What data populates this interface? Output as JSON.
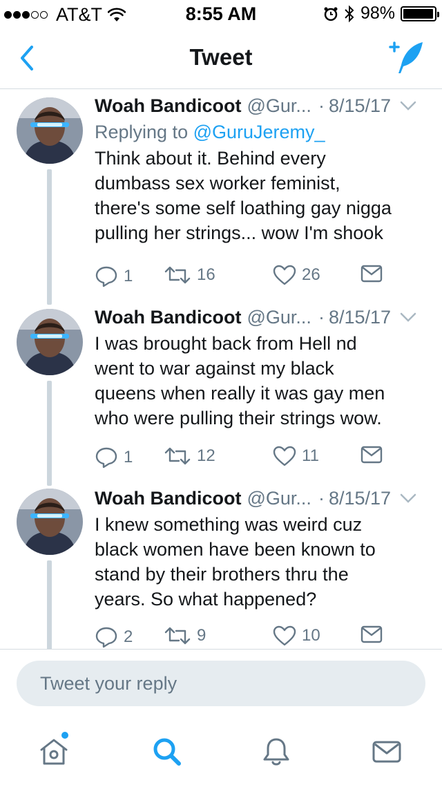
{
  "status_bar": {
    "carrier": "AT&T",
    "time": "8:55 AM",
    "battery_percent": "98%",
    "battery_level": 0.98,
    "signal_bars": [
      true,
      true,
      true,
      false,
      false
    ]
  },
  "nav": {
    "title": "Tweet",
    "back_icon": "chevron-left-icon",
    "compose_icon": "compose-tweet-icon"
  },
  "tweets": [
    {
      "author": "Woah Bandicoot",
      "handle": "@Gur...",
      "separator": "·",
      "date": "8/15/17",
      "replying_prefix": "Replying to ",
      "replying_to": "@GuruJeremy_",
      "text": "Think about it. Behind every\ndumbass sex worker feminist,\nthere's some self loathing gay nigga\npulling her strings... wow I'm shook",
      "replies": "1",
      "retweets": "16",
      "likes": "26"
    },
    {
      "author": "Woah Bandicoot",
      "handle": "@Gur...",
      "separator": "·",
      "date": "8/15/17",
      "text": "I was brought back from Hell nd\nwent to war against my black\nqueens when really it was gay men\nwho were pulling their strings wow.",
      "replies": "1",
      "retweets": "12",
      "likes": "11"
    },
    {
      "author": "Woah Bandicoot",
      "handle": "@Gur...",
      "separator": "·",
      "date": "8/15/17",
      "text": "I knew something was weird cuz\nblack women have been known to\nstand by their brothers thru the\nyears. So what happened?",
      "replies": "2",
      "retweets": "9",
      "likes": "10"
    }
  ],
  "reply_bar": {
    "placeholder": "Tweet your reply"
  },
  "tab_bar": {
    "items": [
      "home-icon",
      "search-icon",
      "notifications-icon",
      "messages-icon"
    ]
  },
  "colors": {
    "accent": "#1da1f2",
    "text_primary": "#14171a",
    "text_secondary": "#657786",
    "divider": "#d5dbe0",
    "thread_line": "#ccd6dd"
  }
}
